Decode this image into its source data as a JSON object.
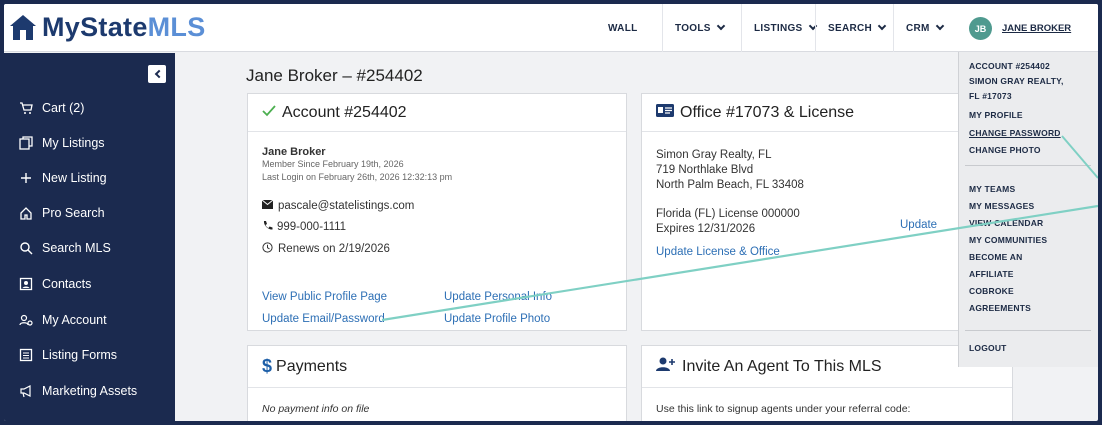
{
  "app": {
    "logo_text_1": "MyState",
    "logo_text_2": "MLS"
  },
  "nav": {
    "wall": "WALL",
    "tools": "TOOLS",
    "listings": "LISTINGS",
    "search": "SEARCH",
    "crm": "CRM",
    "avatar_initials": "JB",
    "user_name": "JANE BROKER"
  },
  "sidebar": {
    "items": [
      {
        "label": "Cart (2)",
        "icon": "cart-icon"
      },
      {
        "label": "My Listings",
        "icon": "listings-icon"
      },
      {
        "label": "New Listing",
        "icon": "plus-icon"
      },
      {
        "label": "Pro Search",
        "icon": "home-icon"
      },
      {
        "label": "Search MLS",
        "icon": "search-icon"
      },
      {
        "label": "Contacts",
        "icon": "contacts-icon"
      },
      {
        "label": "My Account",
        "icon": "account-icon"
      },
      {
        "label": "Listing Forms",
        "icon": "forms-icon"
      },
      {
        "label": "Marketing Assets",
        "icon": "megaphone-icon"
      }
    ]
  },
  "page": {
    "title": "Jane Broker – #254402"
  },
  "account": {
    "header": "Account #254402",
    "name": "Jane Broker",
    "member_since": "Member Since February 19th, 2026",
    "last_login": "Last Login on February 26th, 2026 12:32:13 pm",
    "email": "pascale@statelistings.com",
    "phone": "999-000-1111",
    "renews": "Renews on 2/19/2026",
    "view_profile": "View Public Profile Page",
    "update_personal": "Update Personal Info",
    "update_email": "Update Email/Password",
    "update_photo": "Update Profile Photo"
  },
  "office": {
    "header": "Office #17073 & License",
    "line1": "Simon Gray Realty, FL",
    "line2": "719 Northlake Blvd",
    "line3": "North Palm Beach, FL 33408",
    "license": "Florida (FL) License 000000",
    "expires": "Expires 12/31/2026",
    "update": "Update",
    "update_license": "Update License & Office"
  },
  "payments": {
    "header": "Payments",
    "empty": "No payment info on file"
  },
  "invite": {
    "header": "Invite An Agent To This MLS",
    "text": "Use this link to signup agents under your referral code:"
  },
  "dropdown": {
    "account": "ACCOUNT #254402",
    "company1": "SIMON GRAY REALTY,",
    "company2": "FL #17073",
    "my_profile": "MY PROFILE",
    "change_password": "CHANGE PASSWORD",
    "change_photo": "CHANGE PHOTO",
    "my_teams": "MY TEAMS",
    "my_messages": "MY MESSAGES",
    "view_calendar": "VIEW CALENDAR",
    "my_communities": "MY COMMUNITIES",
    "become_an": "BECOME AN",
    "affiliate": "AFFILIATE",
    "cobroke": "COBROKE",
    "agreements": "AGREEMENTS",
    "logout": "LOGOUT"
  },
  "colors": {
    "navy": "#1b2a4f",
    "accent": "#7fd0c4",
    "link": "#2d6fb5",
    "check": "#4caf50"
  }
}
